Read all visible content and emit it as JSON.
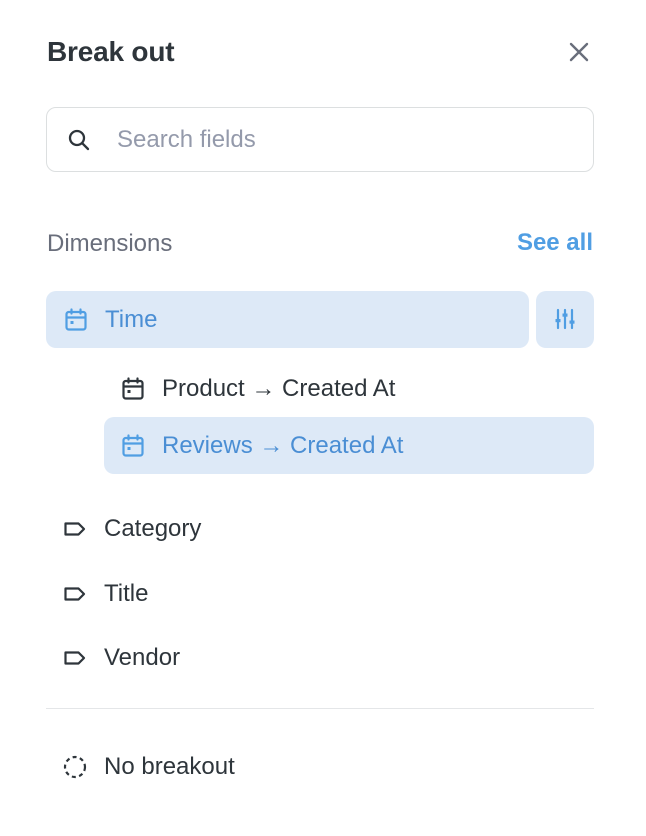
{
  "header": {
    "title": "Break out"
  },
  "search": {
    "placeholder": "Search fields",
    "value": ""
  },
  "section": {
    "label": "Dimensions",
    "see_all_label": "See all"
  },
  "time_group": {
    "label": "Time",
    "children": [
      {
        "label": "Product → Created At",
        "selected": false
      },
      {
        "label": "Reviews → Created At",
        "selected": true
      }
    ]
  },
  "dimensions": [
    {
      "label": "Category",
      "icon": "tag-icon"
    },
    {
      "label": "Title",
      "icon": "tag-icon"
    },
    {
      "label": "Vendor",
      "icon": "tag-icon"
    }
  ],
  "no_breakout": {
    "label": "No breakout",
    "icon": "dashed-circle-icon"
  },
  "colors": {
    "accent": "#509ee3",
    "selected_bg": "#dde9f7",
    "text": "#2e353b",
    "muted": "#696e7b"
  }
}
